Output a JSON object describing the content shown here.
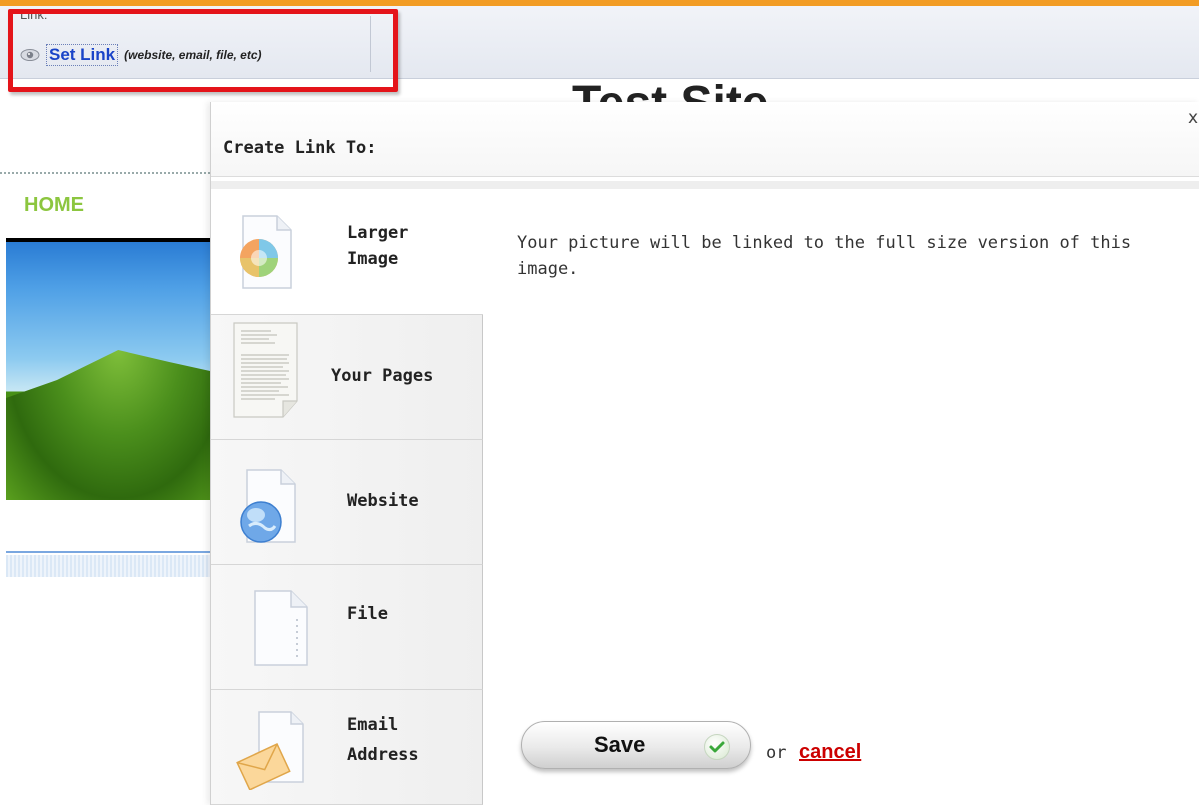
{
  "toolbar": {
    "link_label": "Link:",
    "set_link_label": "Set Link",
    "set_link_hint": "(website, email, file, etc)"
  },
  "site": {
    "title": "Test Site",
    "nav_home": "HOME"
  },
  "dialog": {
    "title": "Create Link To:",
    "close_label": "x",
    "tabs": [
      {
        "label_line1": "Larger",
        "label_line2": "Image",
        "icon": "image-icon",
        "selected": true
      },
      {
        "label_line1": "Your Pages",
        "icon": "page-icon",
        "selected": false
      },
      {
        "label_line1": "Website",
        "icon": "globe-icon",
        "selected": false
      },
      {
        "label_line1": "File",
        "icon": "file-icon",
        "selected": false
      },
      {
        "label_line1": "Email",
        "label_line2": "Address",
        "icon": "envelope-icon",
        "selected": false
      }
    ],
    "content_text": "Your picture will be linked to the full size version of this image.",
    "save_label": "Save",
    "or_text": "or",
    "cancel_label": "cancel"
  },
  "colors": {
    "accent_orange": "#f29c24",
    "highlight_red": "#e4141a",
    "link_blue": "#1a44c8",
    "nav_green": "#8cc63f",
    "cancel_red": "#cc0000"
  }
}
